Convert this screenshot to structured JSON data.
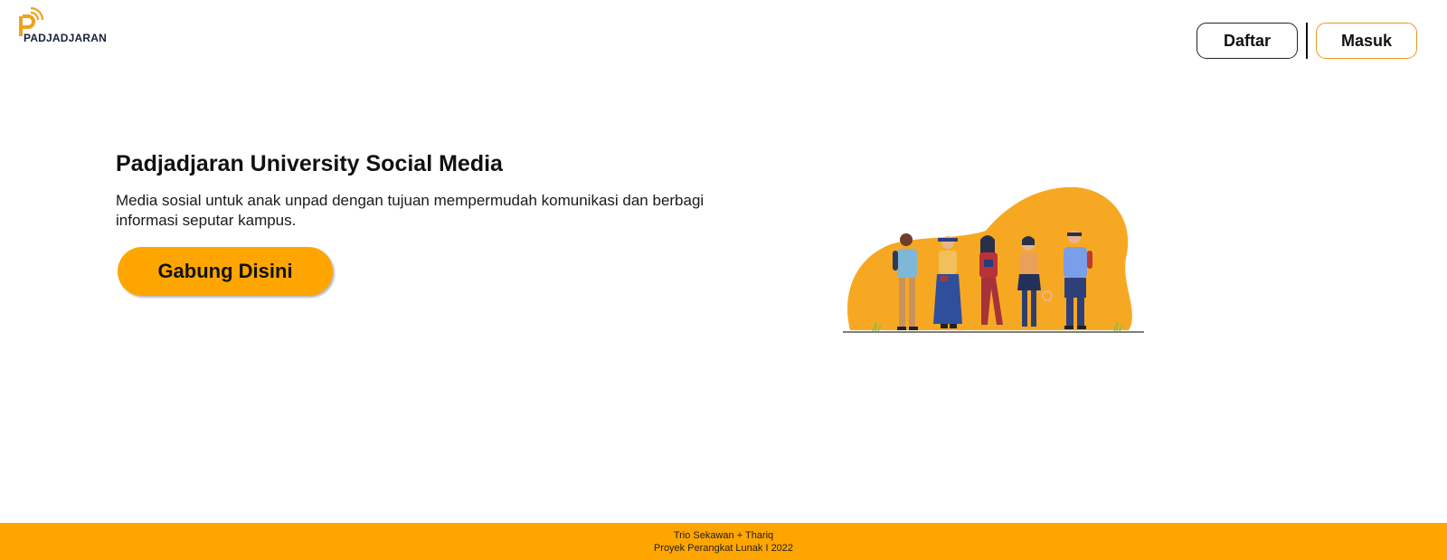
{
  "brand": {
    "name": "PADJADJARAN",
    "logo_icon": "broadcast-p-logo-icon"
  },
  "nav": {
    "register_label": "Daftar",
    "login_label": "Masuk"
  },
  "hero": {
    "title": "Padjadjaran University Social Media",
    "description": "Media sosial untuk anak unpad dengan tujuan mempermudah komunikasi dan berbagi informasi seputar kampus.",
    "cta_label": "Gabung Disini"
  },
  "illustration": {
    "name": "students-group-illustration"
  },
  "footer": {
    "line1": "Trio Sekawan + Thariq",
    "line2": "Proyek Perangkat Lunak I 2022"
  },
  "colors": {
    "accent": "#ffa500",
    "masuk_border": "#e69a1c",
    "text": "#111111"
  }
}
